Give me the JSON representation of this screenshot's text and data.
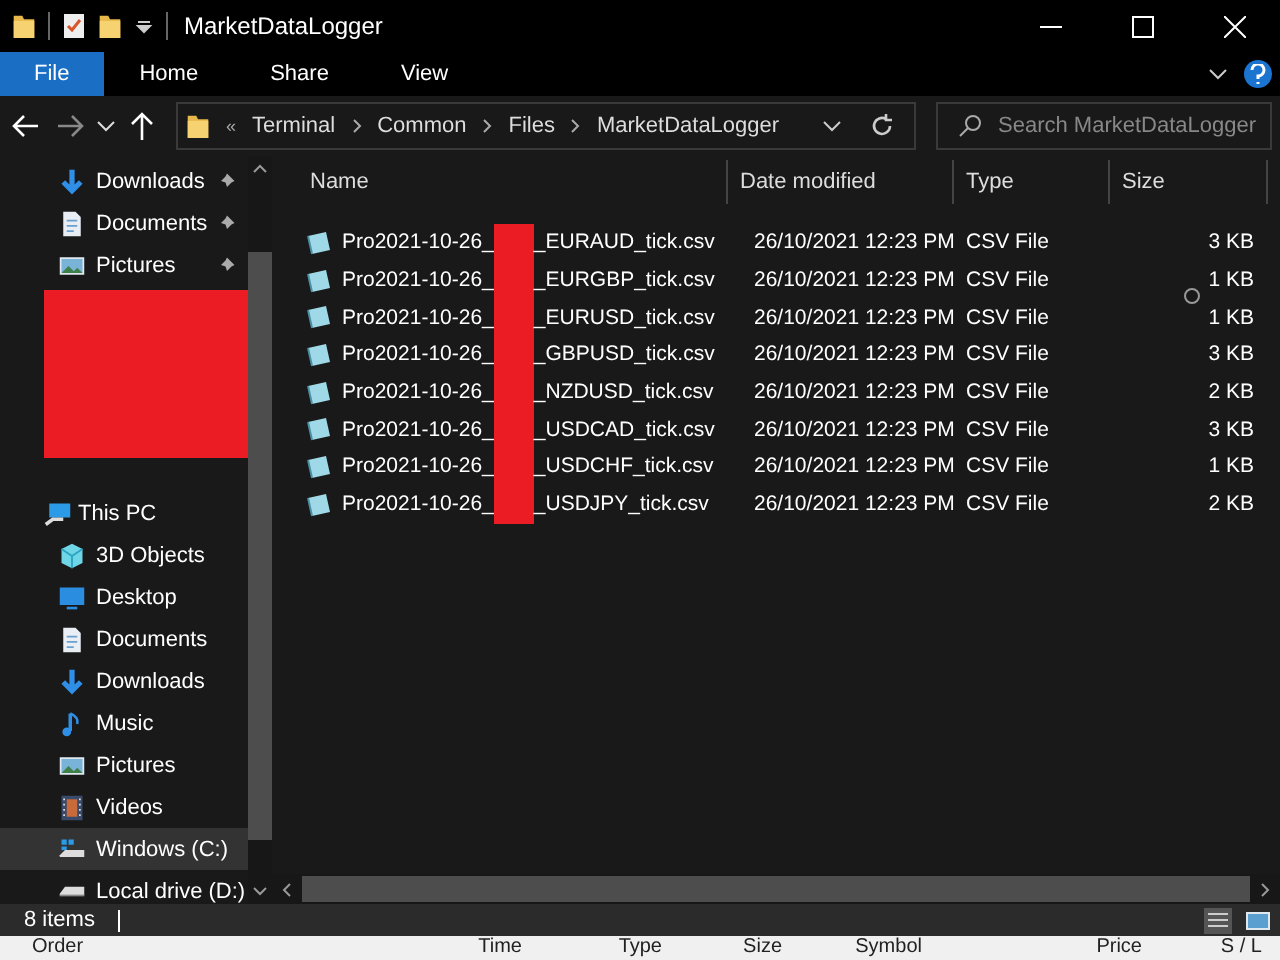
{
  "window": {
    "title": "MarketDataLogger"
  },
  "ribbon_tabs": [
    {
      "label": "File",
      "selected": true
    },
    {
      "label": "Home",
      "selected": false
    },
    {
      "label": "Share",
      "selected": false
    },
    {
      "label": "View",
      "selected": false
    }
  ],
  "address_bar": {
    "overflow": "«",
    "path": [
      "Terminal",
      "Common",
      "Files",
      "MarketDataLogger"
    ]
  },
  "search": {
    "placeholder": "Search MarketDataLogger"
  },
  "sidebar": {
    "quick_access": [
      {
        "label": "Downloads",
        "kind": "download",
        "pinned": true
      },
      {
        "label": "Documents",
        "kind": "document",
        "pinned": true
      },
      {
        "label": "Pictures",
        "kind": "picture",
        "pinned": true
      }
    ],
    "this_pc": {
      "label": "This PC",
      "kind": "pc",
      "children": [
        {
          "label": "3D Objects",
          "kind": "cube",
          "selected": false
        },
        {
          "label": "Desktop",
          "kind": "desktop",
          "selected": false
        },
        {
          "label": "Documents",
          "kind": "document",
          "selected": false
        },
        {
          "label": "Downloads",
          "kind": "download",
          "selected": false
        },
        {
          "label": "Music",
          "kind": "music",
          "selected": false
        },
        {
          "label": "Pictures",
          "kind": "picture",
          "selected": false
        },
        {
          "label": "Videos",
          "kind": "video",
          "selected": false
        },
        {
          "label": "Windows (C:)",
          "kind": "system_drive",
          "selected": true
        },
        {
          "label": "Local drive (D:)",
          "kind": "drive",
          "selected": false
        }
      ]
    }
  },
  "columns": [
    "Name",
    "Date modified",
    "Type",
    "Size"
  ],
  "files": [
    {
      "name_start": "Pro2021-10-26_",
      "name_end": "_EURAUD_tick.csv",
      "date": "26/10/2021 12:23 PM",
      "type": "CSV File",
      "size": "3 KB"
    },
    {
      "name_start": "Pro2021-10-26_",
      "name_end": "_EURGBP_tick.csv",
      "date": "26/10/2021 12:23 PM",
      "type": "CSV File",
      "size": "1 KB"
    },
    {
      "name_start": "Pro2021-10-26_",
      "name_end": "_EURUSD_tick.csv",
      "date": "26/10/2021 12:23 PM",
      "type": "CSV File",
      "size": "1 KB"
    },
    {
      "name_start": "Pro2021-10-26_",
      "name_end": "_GBPUSD_tick.csv",
      "date": "26/10/2021 12:23 PM",
      "type": "CSV File",
      "size": "3 KB"
    },
    {
      "name_start": "Pro2021-10-26_",
      "name_end": "_NZDUSD_tick.csv",
      "date": "26/10/2021 12:23 PM",
      "type": "CSV File",
      "size": "2 KB"
    },
    {
      "name_start": "Pro2021-10-26_",
      "name_end": "_USDCAD_tick.csv",
      "date": "26/10/2021 12:23 PM",
      "type": "CSV File",
      "size": "3 KB"
    },
    {
      "name_start": "Pro2021-10-26_",
      "name_end": "_USDCHF_tick.csv",
      "date": "26/10/2021 12:23 PM",
      "type": "CSV File",
      "size": "1 KB"
    },
    {
      "name_start": "Pro2021-10-26_",
      "name_end": "_USDJPY_tick.csv",
      "date": "26/10/2021 12:23 PM",
      "type": "CSV File",
      "size": "2 KB"
    }
  ],
  "status_bar": {
    "item_count": "8 items"
  },
  "background_window": {
    "columns": [
      "Order",
      "Time",
      "Type",
      "Size",
      "Symbol",
      "Price",
      "S / L"
    ]
  }
}
